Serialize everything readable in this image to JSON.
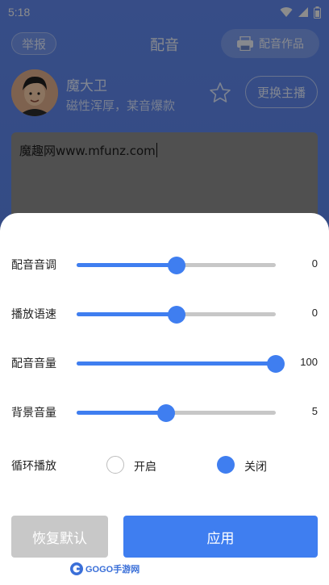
{
  "status_bar": {
    "time": "5:18",
    "icons": [
      "wifi-icon",
      "signal-icon",
      "battery-icon"
    ]
  },
  "header": {
    "report_label": "举报",
    "title": "配音",
    "works_label": "配音作品",
    "works_icon": "printer-icon"
  },
  "anchor": {
    "name": "魔大卫",
    "description": "磁性浑厚，某音爆款",
    "favorite_icon": "star-icon",
    "switch_label": "更换主播"
  },
  "editor": {
    "text": "魔趣网www.mfunz.com"
  },
  "settings": {
    "sliders": [
      {
        "label": "配音音调",
        "value": "0",
        "fraction": 0.5
      },
      {
        "label": "播放语速",
        "value": "0",
        "fraction": 0.5
      },
      {
        "label": "配音音量",
        "value": "100",
        "fraction": 1.0
      },
      {
        "label": "背景音量",
        "value": "5",
        "fraction": 0.45
      }
    ],
    "loop": {
      "label": "循环播放",
      "options": [
        {
          "label": "开启",
          "selected": false
        },
        {
          "label": "关闭",
          "selected": true
        }
      ]
    },
    "reset_label": "恢复默认",
    "apply_label": "应用"
  },
  "colors": {
    "accent": "#3f7ef0",
    "track": "#c7c7c7",
    "reset_bg": "#c8c8c8"
  },
  "watermark": {
    "text": "GOGO手游网"
  }
}
